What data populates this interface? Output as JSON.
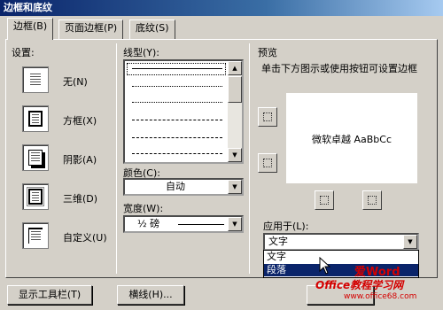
{
  "window": {
    "title": "边框和底纹"
  },
  "tabs": [
    {
      "label": "边框(B)"
    },
    {
      "label": "页面边框(P)"
    },
    {
      "label": "底纹(S)"
    }
  ],
  "settings": {
    "heading": "设置:",
    "items": [
      {
        "label": "无(N)",
        "icon": "setting-none-icon"
      },
      {
        "label": "方框(X)",
        "icon": "setting-box-icon"
      },
      {
        "label": "阴影(A)",
        "icon": "setting-shadow-icon"
      },
      {
        "label": "三维(D)",
        "icon": "setting-3d-icon"
      },
      {
        "label": "自定义(U)",
        "icon": "setting-custom-icon"
      }
    ]
  },
  "line_style": {
    "label": "线型(Y):"
  },
  "color": {
    "label": "颜色(C):",
    "value": "自动"
  },
  "width": {
    "label": "宽度(W):",
    "value": "½ 磅"
  },
  "preview": {
    "heading": "预览",
    "hint": "单击下方图示或使用按钮可设置边框",
    "sample_text": "微软卓越 AaBbCc"
  },
  "apply_to": {
    "label": "应用于(L):",
    "value": "文字",
    "options": [
      "文字",
      "段落"
    ],
    "highlighted": "段落"
  },
  "footer": {
    "toolbar_button": "显示工具栏(T)",
    "hline_button": "横线(H)..."
  },
  "watermark": {
    "line1": "爱Word",
    "line2": "Office教程学习网",
    "url": "www.office68.com"
  }
}
